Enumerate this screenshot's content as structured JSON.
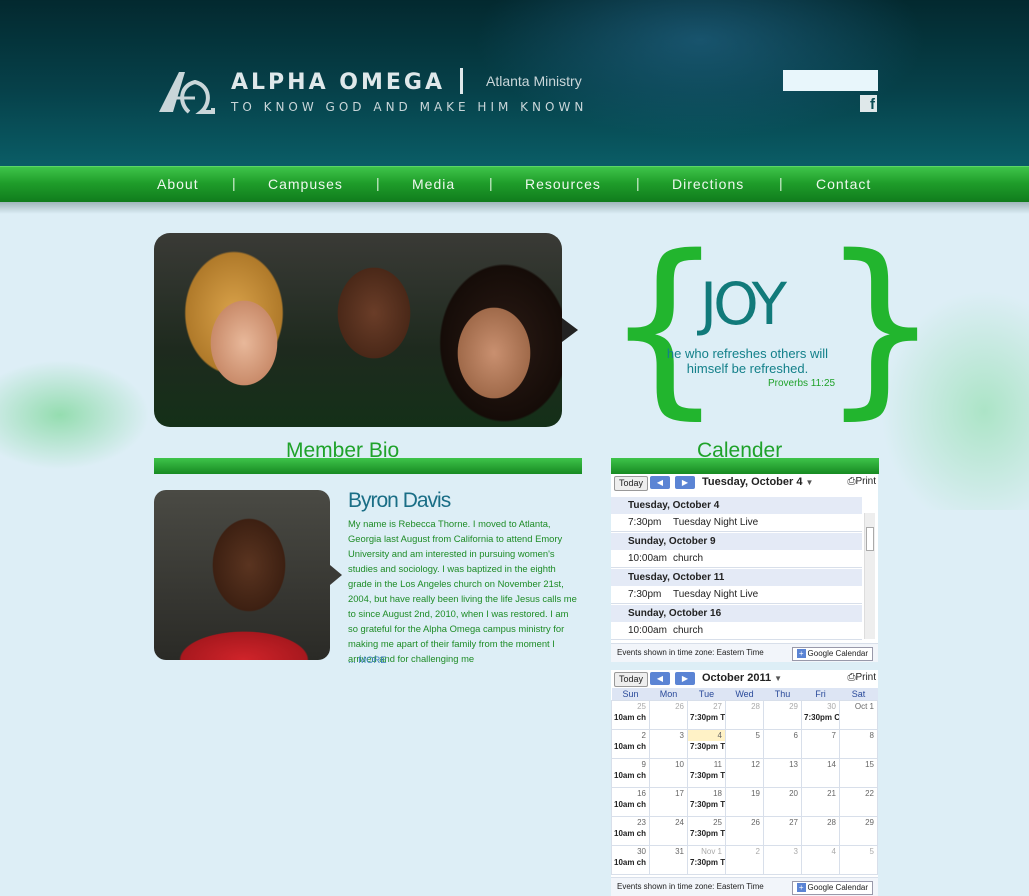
{
  "header": {
    "brand": "ALPHA OMEGA",
    "ministry": "Atlanta Ministry",
    "tagline": "TO KNOW GOD AND MAKE HIM KNOWN",
    "facebook_glyph": "f"
  },
  "nav": {
    "items": [
      "About",
      "Campuses",
      "Media",
      "Resources",
      "Directions",
      "Contact"
    ],
    "separator": "|"
  },
  "hero": {
    "title": "JOY",
    "quote": "he who refreshes others will himself be refreshed.",
    "reference": "Proverbs 11:25"
  },
  "member_bio": {
    "section_title": "Member Bio",
    "name": "Byron Davis",
    "text": "My name is Rebecca Thorne. I moved to Atlanta, Georgia last August from California to attend Emory University and am interested in pursuing women's studies and sociology. I was baptized in the eighth grade in the Los Angeles church on November 21st, 2004, but have really been living the life Jesus calls me to since August 2nd, 2010, when I was restored. I am so grateful for the Alpha Omega campus ministry for making me apart of their family from the moment I arrived and for challenging me",
    "more_label": "... MORE"
  },
  "calendar": {
    "section_title": "Calender",
    "today_label": "Today",
    "print_label": "Print",
    "timezone_note": "Events shown in time zone: Eastern Time",
    "google_button": "Google Calendar",
    "agenda": {
      "date_label": "Tuesday, October 4",
      "days": [
        {
          "day": "Tuesday, October 4",
          "events": [
            {
              "time": "7:30pm",
              "title": "Tuesday Night Live"
            }
          ]
        },
        {
          "day": "Sunday, October 9",
          "events": [
            {
              "time": "10:00am",
              "title": "church"
            }
          ]
        },
        {
          "day": "Tuesday, October 11",
          "events": [
            {
              "time": "7:30pm",
              "title": "Tuesday Night Live"
            }
          ]
        },
        {
          "day": "Sunday, October 16",
          "events": [
            {
              "time": "10:00am",
              "title": "church"
            }
          ]
        }
      ]
    },
    "month": {
      "label": "October 2011",
      "weekdays": [
        "Sun",
        "Mon",
        "Tue",
        "Wed",
        "Thu",
        "Fri",
        "Sat"
      ],
      "weeks": [
        [
          {
            "d": "25",
            "o": true,
            "e": "10am ch"
          },
          {
            "d": "26",
            "o": true
          },
          {
            "d": "27",
            "o": true,
            "e": "7:30pm T"
          },
          {
            "d": "28",
            "o": true
          },
          {
            "d": "29",
            "o": true
          },
          {
            "d": "30",
            "o": true,
            "e": "7:30pm C"
          },
          {
            "d": "Oct 1"
          }
        ],
        [
          {
            "d": "2",
            "e": "10am ch"
          },
          {
            "d": "3"
          },
          {
            "d": "4",
            "t": true,
            "e": "7:30pm T"
          },
          {
            "d": "5"
          },
          {
            "d": "6"
          },
          {
            "d": "7"
          },
          {
            "d": "8"
          }
        ],
        [
          {
            "d": "9",
            "e": "10am ch"
          },
          {
            "d": "10"
          },
          {
            "d": "11",
            "e": "7:30pm T"
          },
          {
            "d": "12"
          },
          {
            "d": "13"
          },
          {
            "d": "14"
          },
          {
            "d": "15"
          }
        ],
        [
          {
            "d": "16",
            "e": "10am ch"
          },
          {
            "d": "17"
          },
          {
            "d": "18",
            "e": "7:30pm T"
          },
          {
            "d": "19"
          },
          {
            "d": "20"
          },
          {
            "d": "21"
          },
          {
            "d": "22"
          }
        ],
        [
          {
            "d": "23",
            "e": "10am ch"
          },
          {
            "d": "24"
          },
          {
            "d": "25",
            "e": "7:30pm T"
          },
          {
            "d": "26"
          },
          {
            "d": "27"
          },
          {
            "d": "28"
          },
          {
            "d": "29"
          }
        ],
        [
          {
            "d": "30",
            "e": "10am ch"
          },
          {
            "d": "31"
          },
          {
            "d": "Nov 1",
            "o": true,
            "e": "7:30pm T"
          },
          {
            "d": "2",
            "o": true
          },
          {
            "d": "3",
            "o": true
          },
          {
            "d": "4",
            "o": true
          },
          {
            "d": "5",
            "o": true
          }
        ]
      ]
    }
  },
  "colors": {
    "header_dark": "#03292f",
    "nav_green": "#1f9d2a",
    "accent_green": "#22b52e",
    "teal_text": "#117a7a",
    "page_bg": "#ddeef6"
  },
  "icons": [
    "alpha-omega-logo-icon",
    "facebook-icon",
    "print-icon",
    "prev-arrow-icon",
    "next-arrow-icon",
    "dropdown-icon"
  ]
}
